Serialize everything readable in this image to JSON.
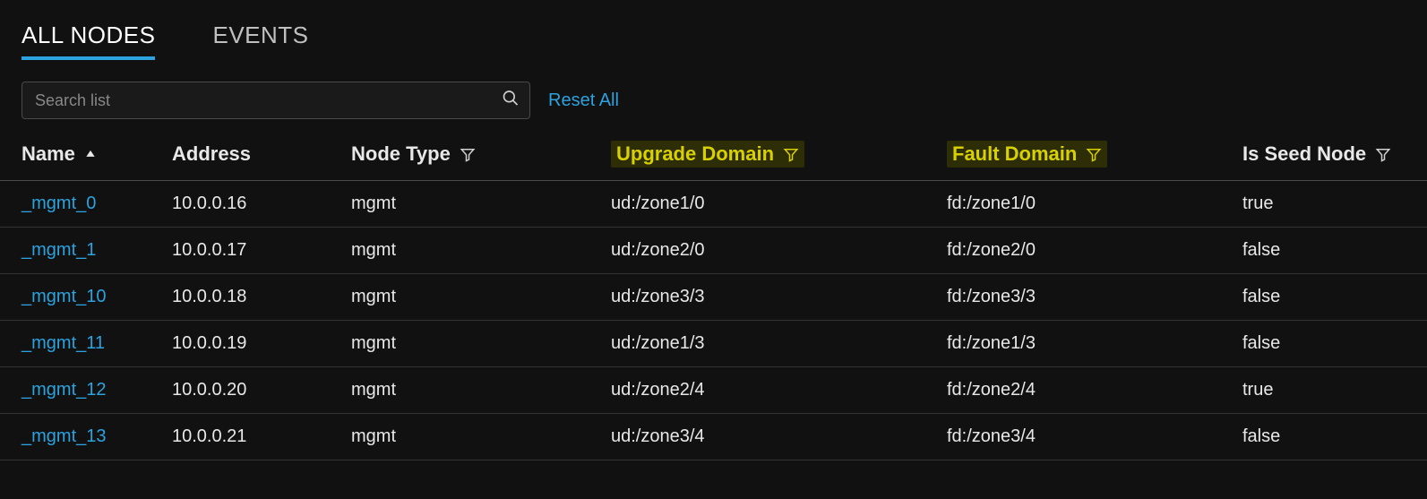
{
  "tabs": {
    "items": [
      {
        "label": "ALL NODES",
        "active": true
      },
      {
        "label": "EVENTS",
        "active": false
      }
    ]
  },
  "toolbar": {
    "search_placeholder": "Search list",
    "search_value": "",
    "reset_label": "Reset All"
  },
  "columns": [
    {
      "key": "name",
      "label": "Name",
      "sort": "asc",
      "filter": false,
      "highlight": false
    },
    {
      "key": "address",
      "label": "Address",
      "sort": null,
      "filter": false,
      "highlight": false
    },
    {
      "key": "type",
      "label": "Node Type",
      "sort": null,
      "filter": true,
      "highlight": false
    },
    {
      "key": "ud",
      "label": "Upgrade Domain",
      "sort": null,
      "filter": true,
      "highlight": true
    },
    {
      "key": "fd",
      "label": "Fault Domain",
      "sort": null,
      "filter": true,
      "highlight": true
    },
    {
      "key": "seed",
      "label": "Is Seed Node",
      "sort": null,
      "filter": true,
      "highlight": false
    }
  ],
  "rows": [
    {
      "name": "_mgmt_0",
      "address": "10.0.0.16",
      "type": "mgmt",
      "ud": "ud:/zone1/0",
      "fd": "fd:/zone1/0",
      "seed": "true"
    },
    {
      "name": "_mgmt_1",
      "address": "10.0.0.17",
      "type": "mgmt",
      "ud": "ud:/zone2/0",
      "fd": "fd:/zone2/0",
      "seed": "false"
    },
    {
      "name": "_mgmt_10",
      "address": "10.0.0.18",
      "type": "mgmt",
      "ud": "ud:/zone3/3",
      "fd": "fd:/zone3/3",
      "seed": "false"
    },
    {
      "name": "_mgmt_11",
      "address": "10.0.0.19",
      "type": "mgmt",
      "ud": "ud:/zone1/3",
      "fd": "fd:/zone1/3",
      "seed": "false"
    },
    {
      "name": "_mgmt_12",
      "address": "10.0.0.20",
      "type": "mgmt",
      "ud": "ud:/zone2/4",
      "fd": "fd:/zone2/4",
      "seed": "true"
    },
    {
      "name": "_mgmt_13",
      "address": "10.0.0.21",
      "type": "mgmt",
      "ud": "ud:/zone3/4",
      "fd": "fd:/zone3/4",
      "seed": "false"
    }
  ],
  "colors": {
    "accent": "#2ca2df",
    "highlight_text": "#d8d000",
    "highlight_bg": "#2d2d06"
  }
}
